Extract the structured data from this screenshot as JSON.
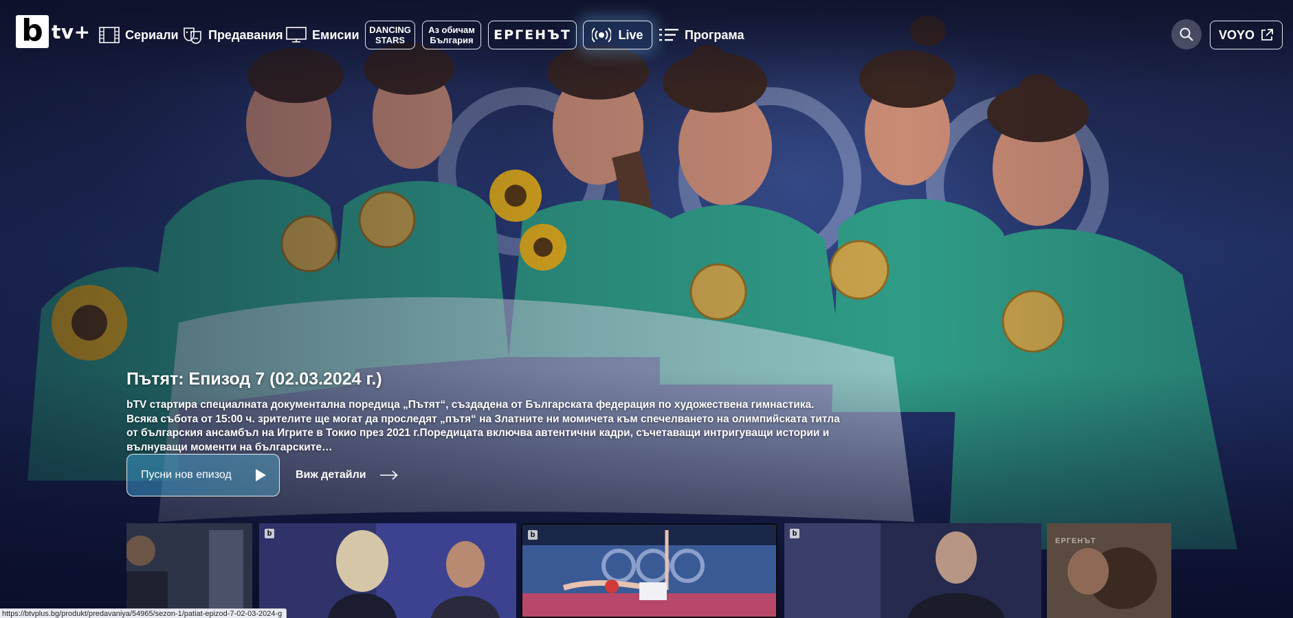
{
  "brand": {
    "logo_letter": "b",
    "logo_text": "tv+"
  },
  "nav": {
    "series": "Сериали",
    "shows": "Предавания",
    "broadcasts": "Емисии",
    "dancing_stars_line1": "DANCING",
    "dancing_stars_line2": "STARS",
    "az_obicham_line1": "Аз обичам",
    "az_obicham_line2": "България",
    "ergenat": "ЕРГЕНЪТ",
    "live": "Live",
    "program": "Програма",
    "voyo": "VOYO"
  },
  "icons": {
    "series": "film-strip-icon",
    "shows": "theater-masks-icon",
    "broadcasts": "monitor-icon",
    "live": "broadcast-icon",
    "program": "list-icon",
    "search": "search-icon",
    "external": "external-link-icon",
    "play": "play-icon",
    "arrow": "arrow-right-icon"
  },
  "hero": {
    "title": "Пътят: Епизод 7 (02.03.2024 г.)",
    "description": "bTV стартира специалната документална поредица „Пътят“, създадена от Българската федерация по художествена гимнастика. Всяка събота от 15:00 ч. зрителите ще могат да проследят „пътя“ на Златните ни момичета към спечелването на олимпийската титла от българския ансамбъл на Игрите в Токио през 2021 г.Поредицата включва автентични кадри, съчетаващи интригуващи истории и вълнуващи моменти на българските…",
    "play_label": "Пусни нов епизод",
    "details_label": "Виж детайли"
  },
  "thumbnails": [
    {
      "logo": "",
      "caption": ""
    },
    {
      "logo": "b",
      "caption": ""
    },
    {
      "logo": "b",
      "caption": ""
    },
    {
      "logo": "b",
      "caption": ""
    },
    {
      "logo": "",
      "caption": "ЕРГЕНЪТ"
    }
  ],
  "status_url": "https://btvplus.bg/produkt/predavaniya/54965/sezon-1/patiat-epizod-7-02-03-2024-g",
  "colors": {
    "accent_teal": "#5ab8d6",
    "jacket_green": "#2f9c86",
    "background_navy": "#1a2350"
  }
}
